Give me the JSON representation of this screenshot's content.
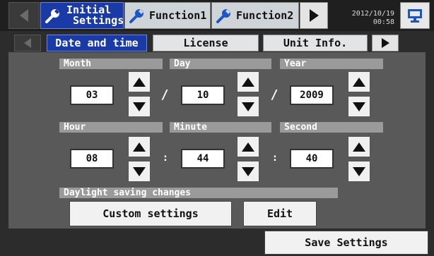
{
  "top_tabs": [
    {
      "line1": "Initial",
      "line2": "Settings"
    },
    {
      "label": "Function1"
    },
    {
      "label": "Function2"
    }
  ],
  "clock": {
    "date": "2012/10/19",
    "time": "00:58"
  },
  "sub_tabs": [
    "Date and time",
    "License",
    "Unit Info."
  ],
  "fields": {
    "month": {
      "label": "Month",
      "value": "03"
    },
    "day": {
      "label": "Day",
      "value": "10"
    },
    "year": {
      "label": "Year",
      "value": "2009"
    },
    "hour": {
      "label": "Hour",
      "value": "08"
    },
    "minute": {
      "label": "Minute",
      "value": "44"
    },
    "second": {
      "label": "Second",
      "value": "40"
    }
  },
  "separators": {
    "date": "/",
    "time": ":"
  },
  "daylight": {
    "header": "Daylight saving changes",
    "custom_button": "Custom settings",
    "edit_button": "Edit"
  },
  "save_button": "Save Settings",
  "icons": [
    "left-arrow-icon",
    "wrench-icon",
    "right-arrow-icon",
    "monitor-icon",
    "up-arrow-icon",
    "down-arrow-icon"
  ],
  "colors": {
    "active_tab": "#1a3aa8",
    "panel": "#595959",
    "header_strip": "#9a9a9a"
  }
}
